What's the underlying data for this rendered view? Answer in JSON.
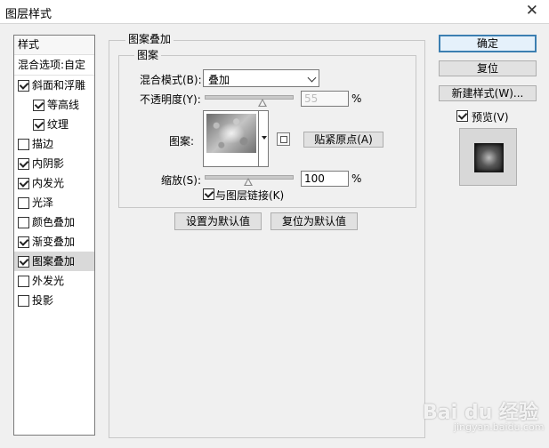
{
  "window": {
    "title": "图层样式",
    "close_glyph": "✕"
  },
  "style_list": {
    "header": "样式",
    "blend_options": "混合选项:自定",
    "items": [
      {
        "label": "斜面和浮雕",
        "checked": true,
        "selected": false,
        "indent": false
      },
      {
        "label": "等高线",
        "checked": true,
        "selected": false,
        "indent": true
      },
      {
        "label": "纹理",
        "checked": true,
        "selected": false,
        "indent": true
      },
      {
        "label": "描边",
        "checked": false,
        "selected": false,
        "indent": false
      },
      {
        "label": "内阴影",
        "checked": true,
        "selected": false,
        "indent": false
      },
      {
        "label": "内发光",
        "checked": true,
        "selected": false,
        "indent": false
      },
      {
        "label": "光泽",
        "checked": false,
        "selected": false,
        "indent": false
      },
      {
        "label": "颜色叠加",
        "checked": false,
        "selected": false,
        "indent": false
      },
      {
        "label": "渐变叠加",
        "checked": true,
        "selected": false,
        "indent": false
      },
      {
        "label": "图案叠加",
        "checked": true,
        "selected": true,
        "indent": false
      },
      {
        "label": "外发光",
        "checked": false,
        "selected": false,
        "indent": false
      },
      {
        "label": "投影",
        "checked": false,
        "selected": false,
        "indent": false
      }
    ]
  },
  "pattern_overlay": {
    "group_title": "图案叠加",
    "subgroup_title": "图案",
    "blend_mode_label": "混合模式(B):",
    "blend_mode_value": "叠加",
    "opacity_label": "不透明度(Y):",
    "opacity_value": "55",
    "opacity_unit": "%",
    "pattern_label": "图案:",
    "snap_button": "贴紧原点(A)",
    "scale_label": "缩放(S):",
    "scale_value": "100",
    "scale_unit": "%",
    "link_label": "与图层链接(K)",
    "link_checked": true,
    "make_default_button": "设置为默认值",
    "reset_default_button": "复位为默认值"
  },
  "buttons": {
    "ok": "确定",
    "reset": "复位",
    "new_style": "新建样式(W)...",
    "preview_label": "预览(V)",
    "preview_checked": true
  },
  "watermark": {
    "logo": "Bai du 经验",
    "url": "jingyan.baidu.com"
  }
}
